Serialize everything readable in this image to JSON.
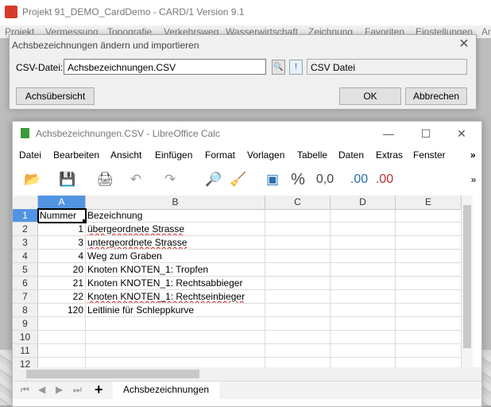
{
  "background_app": {
    "title": "Projekt 91_DEMO_CardDemo - CARD/1 Version 9.1",
    "menu": [
      "Projekt",
      "Vermessung",
      "Topografie",
      "Verkehrsweg",
      "Wasserwirtschaft",
      "Zeichnung",
      "Favoriten",
      "Einstellungen",
      "An"
    ]
  },
  "dialog": {
    "title": "Achsbezeichnungen ändern und importieren",
    "close": "✕",
    "csv_label": "CSV-Datei:",
    "csv_value": "Achsbezeichnungen.CSV",
    "csv_browse": "🔍",
    "csv_info": "!",
    "csv_type": "CSV Datei",
    "buttons": {
      "overview": "Achsübersicht",
      "ok": "OK",
      "cancel": "Abbrechen"
    }
  },
  "calc": {
    "title": "Achsbezeichnungen.CSV - LibreOffice Calc",
    "controls": {
      "minimize": "—",
      "maximize": "☐",
      "close": "✕"
    },
    "menu": [
      "Datei",
      "Bearbeiten",
      "Ansicht",
      "Einfügen",
      "Format",
      "Vorlagen",
      "Tabelle",
      "Daten",
      "Extras",
      "Fenster"
    ],
    "menu_more": "»",
    "toolbar": {
      "open_icon": "📂",
      "save_icon": "💾",
      "print_icon": "🖨",
      "undo_icon": "↶",
      "redo_icon": "↷",
      "find_icon": "🔎",
      "clear_icon": "🧹",
      "currency_icon": "▣",
      "percent": "%",
      "number_format": "0,0",
      "add_decimal": ".00",
      "remove_decimal": ".00",
      "more": "»"
    },
    "columns": [
      "A",
      "B",
      "C",
      "D",
      "E"
    ],
    "rows": [
      {
        "n": "1",
        "a": "Nummer",
        "b": "Bezeichnung"
      },
      {
        "n": "2",
        "a": "1",
        "b": "übergeordnete Strasse"
      },
      {
        "n": "3",
        "a": "3",
        "b": "untergeordnete Strasse"
      },
      {
        "n": "4",
        "a": "4",
        "b": "Weg zum Graben"
      },
      {
        "n": "5",
        "a": "20",
        "b": "Knoten KNOTEN_1: Tropfen"
      },
      {
        "n": "6",
        "a": "21",
        "b": "Knoten KNOTEN_1: Rechtsabbieger"
      },
      {
        "n": "7",
        "a": "22",
        "b": "Knoten KNOTEN_1: Rechtseinbieger"
      },
      {
        "n": "8",
        "a": "120",
        "b": "Leitlinie für Schleppkurve"
      },
      {
        "n": "9",
        "a": "",
        "b": ""
      },
      {
        "n": "10",
        "a": "",
        "b": ""
      },
      {
        "n": "11",
        "a": "",
        "b": ""
      },
      {
        "n": "12",
        "a": "",
        "b": ""
      }
    ],
    "sheet_tab": "Achsbezeichnungen",
    "add_sheet": "+",
    "nav": [
      "⏮",
      "◀",
      "▶",
      "⏭"
    ]
  }
}
